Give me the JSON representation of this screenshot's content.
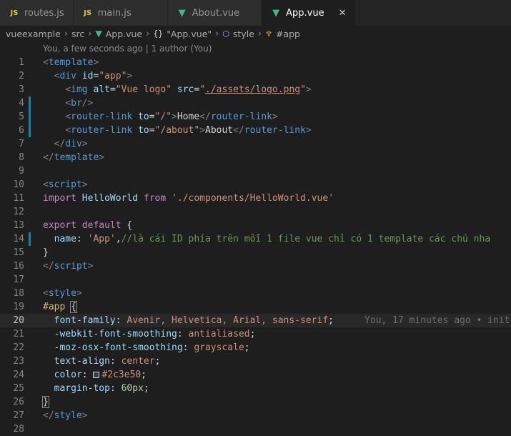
{
  "tabs": [
    {
      "icon": "JS",
      "label": "routes.js",
      "active": false
    },
    {
      "icon": "JS",
      "label": "main.js",
      "active": false
    },
    {
      "icon": "V",
      "label": "About.vue",
      "active": false
    },
    {
      "icon": "V",
      "label": "App.vue",
      "active": true,
      "close": "✕"
    }
  ],
  "breadcrumb": {
    "folder1": "vueexample",
    "folder2": "src",
    "file": "App.vue",
    "braces": "{}",
    "component": "\"App.vue\"",
    "section": "style",
    "selector": "#app"
  },
  "blame_header": "You, a few seconds ago | 1 author (You)",
  "inline_blame_20": "You, 17 minutes ago • init",
  "lines": {
    "l2_id": "\"app\"",
    "l3_alt": "\"Vue logo\"",
    "l3_src": "./assets/logo.png",
    "l5_to": "\"/\"",
    "l5_text": "Home",
    "l6_to": "\"/about\"",
    "l6_text": "About",
    "l11_ident": "HelloWorld",
    "l11_path": "'./components/HelloWorld.vue'",
    "l14_value": "'App'",
    "l14_comment": "//là cái ID phía trên mỗi 1 file vue chỉ có 1 template các chú nha",
    "l20_values": "Avenir, Helvetica, Arial, sans-serif",
    "l21_value": "antialiased",
    "l22_value": "grayscale",
    "l23_value": "center",
    "l24_value": "#2c3e50",
    "l25_value": "60px"
  },
  "colors": {
    "swatch": "#2c3e50",
    "accent": "#41b883"
  }
}
